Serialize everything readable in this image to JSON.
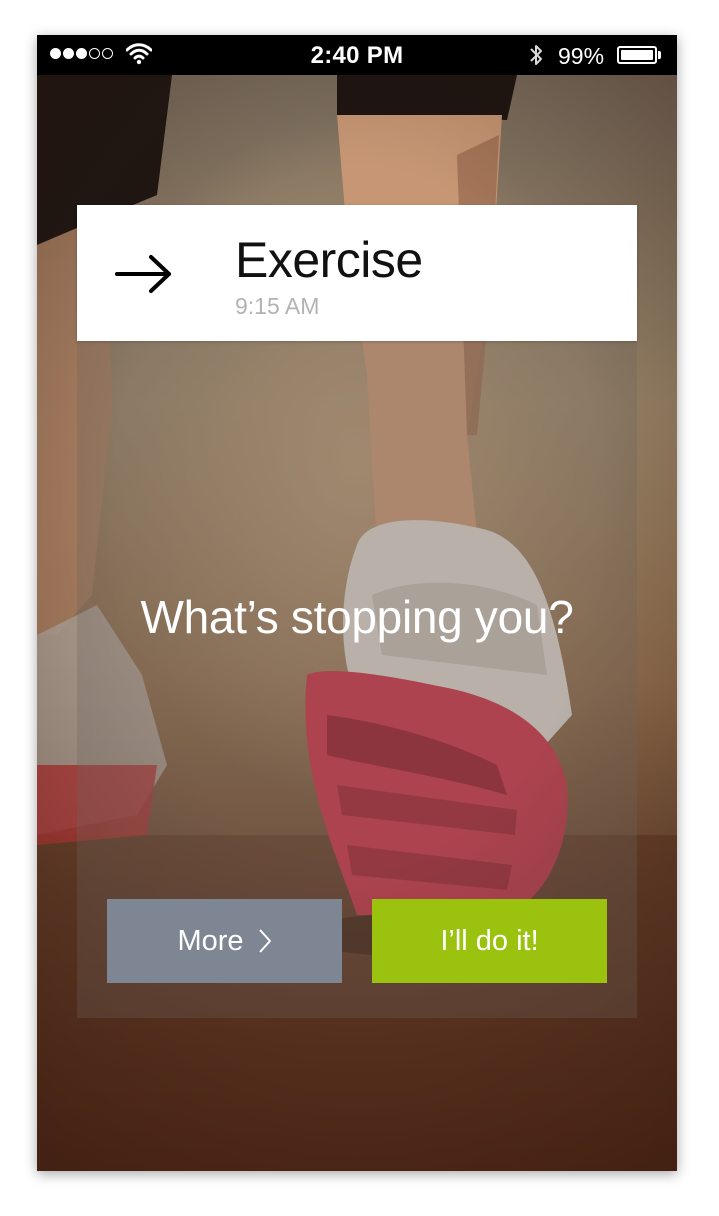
{
  "status_bar": {
    "signal_dots_filled": 3,
    "signal_dots_total": 5,
    "time": "2:40 PM",
    "battery_percent": "99%",
    "icons": [
      "signal-dots",
      "wifi-icon",
      "bluetooth-icon",
      "battery-icon"
    ]
  },
  "card": {
    "icon": "arrow-right-icon",
    "title": "Exercise",
    "time": "9:15 AM",
    "question": "What’s stopping you?",
    "buttons": {
      "more_label": "More",
      "more_icon": "chevron-right-icon",
      "do_it_label": "I’ll do it!"
    }
  },
  "colors": {
    "more_button": "#7e8593",
    "do_it_button": "#9bc20f",
    "status_bar": "#000000",
    "header_bg": "#ffffff",
    "subtitle_gray": "#b3b3b3"
  }
}
